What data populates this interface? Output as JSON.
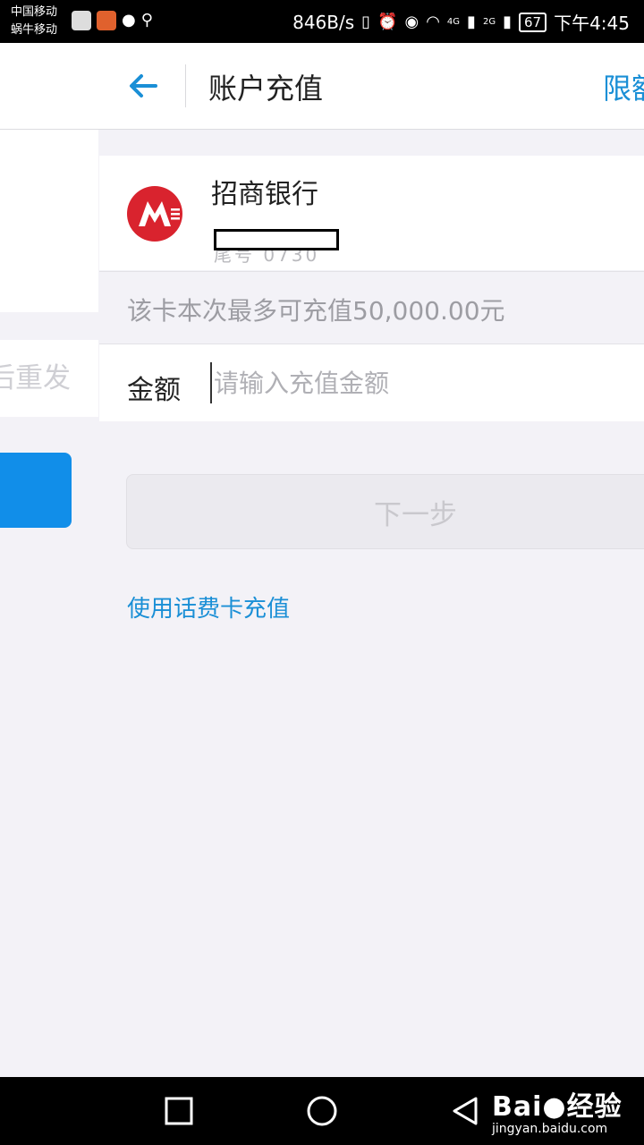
{
  "status_bar": {
    "carrier_1": "中国移动",
    "carrier_2": "蜗牛移动",
    "net_speed": "846B/s",
    "net_4g": "4G",
    "net_2g": "2G",
    "battery": "67",
    "time": "下午4:45"
  },
  "background_panel": {
    "resend_text": "后重发"
  },
  "header": {
    "title": "账户充值",
    "right_link": "限额"
  },
  "bank_card": {
    "name": "招商银行",
    "masked_number": "尾号 0730"
  },
  "notice": {
    "text": "该卡本次最多可充值50,000.00元"
  },
  "amount": {
    "label": "金额",
    "placeholder": "请输入充值金额",
    "value": ""
  },
  "next_button": {
    "label": "下一步"
  },
  "links": {
    "phone_card": "使用话费卡充值"
  },
  "watermark": {
    "logo": "Bai",
    "logo_suffix": "经验",
    "url": "jingyan.baidu.com"
  },
  "colors": {
    "accent": "#1a8fd6",
    "bank_red": "#d9232e",
    "page_bg": "#f3f2f7"
  },
  "icons": {
    "back": "arrow-left-icon",
    "nav_back": "triangle-back-icon",
    "nav_home": "circle-home-icon",
    "nav_recent": "square-recent-icon"
  }
}
